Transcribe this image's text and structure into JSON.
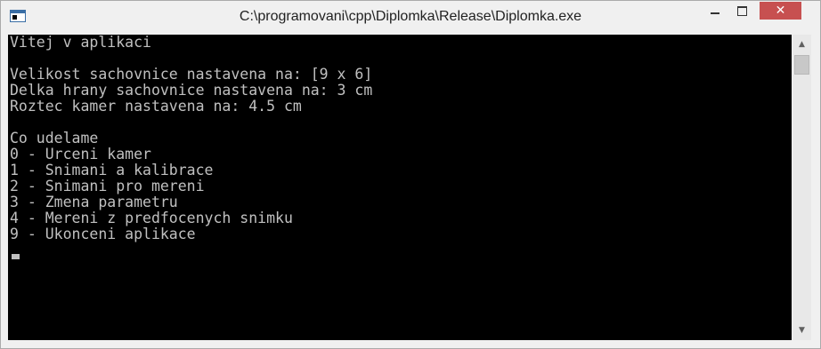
{
  "window": {
    "title": "C:\\programovani\\cpp\\Diplomka\\Release\\Diplomka.exe",
    "controls": {
      "minimize": "minimize-icon",
      "maximize": "maximize-icon",
      "close": "close-icon"
    }
  },
  "console": {
    "lines": [
      "Vitej v aplikaci",
      "",
      "Velikost sachovnice nastavena na: [9 x 6]",
      "Delka hrany sachovnice nastavena na: 3 cm",
      "Roztec kamer nastavena na: 4.5 cm",
      "",
      "Co udelame",
      "0 - Urceni kamer",
      "1 - Snimani a kalibrace",
      "2 - Snimani pro mereni",
      "3 - Zmena parametru",
      "4 - Mereni z predfocenych snimku",
      "9 - Ukonceni aplikace"
    ]
  },
  "colors": {
    "console_background": "#000000",
    "console_text": "#c0c0c0",
    "close_button": "#c75050"
  }
}
